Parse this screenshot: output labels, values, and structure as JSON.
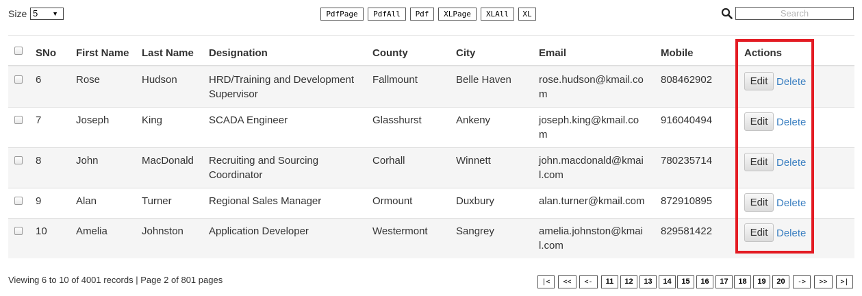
{
  "toolbar": {
    "size_label": "Size",
    "size_value": "5",
    "export_buttons": [
      "PdfPage",
      "PdfAll",
      "Pdf",
      "XLPage",
      "XLAll",
      "XL"
    ],
    "search_placeholder": "Search"
  },
  "table": {
    "columns": [
      "SNo",
      "First Name",
      "Last Name",
      "Designation",
      "County",
      "City",
      "Email",
      "Mobile",
      "Actions"
    ],
    "rows": [
      {
        "sno": "6",
        "first": "Rose",
        "last": "Hudson",
        "designation": [
          "HRD/Training and Development",
          "Supervisor"
        ],
        "county": "Fallmount",
        "city": "Belle Haven",
        "email": [
          "rose.hudson@kmail.co",
          "m"
        ],
        "mobile": "808462902"
      },
      {
        "sno": "7",
        "first": "Joseph",
        "last": "King",
        "designation": [
          "SCADA Engineer"
        ],
        "county": "Glasshurst",
        "city": "Ankeny",
        "email": [
          "joseph.king@kmail.co",
          "m"
        ],
        "mobile": "916040494"
      },
      {
        "sno": "8",
        "first": "John",
        "last": "MacDonald",
        "designation": [
          "Recruiting and Sourcing",
          "Coordinator"
        ],
        "county": "Corhall",
        "city": "Winnett",
        "email": [
          "john.macdonald@kmai",
          "l.com"
        ],
        "mobile": "780235714"
      },
      {
        "sno": "9",
        "first": "Alan",
        "last": "Turner",
        "designation": [
          "Regional Sales Manager"
        ],
        "county": "Ormount",
        "city": "Duxbury",
        "email": [
          "alan.turner@kmail.com"
        ],
        "mobile": "872910895"
      },
      {
        "sno": "10",
        "first": "Amelia",
        "last": "Johnston",
        "designation": [
          "Application Developer"
        ],
        "county": "Westermont",
        "city": "Sangrey",
        "email": [
          "amelia.johnston@kmai",
          "l.com"
        ],
        "mobile": "829581422"
      }
    ],
    "edit_label": "Edit",
    "delete_label": "Delete"
  },
  "footer": {
    "summary": "Viewing 6 to 10 of 4001 records | Page 2 of 801 pages",
    "pager_first": "|<",
    "pager_prev_block": "<<",
    "pager_prev": "<-",
    "pages": [
      "11",
      "12",
      "13",
      "14",
      "15",
      "16",
      "17",
      "18",
      "19",
      "20"
    ],
    "pager_next": "->",
    "pager_next_block": ">>",
    "pager_last": ">|"
  },
  "colors": {
    "highlight": "#e31b23",
    "link": "#3a7fc1",
    "row_alt": "#f5f5f5"
  }
}
